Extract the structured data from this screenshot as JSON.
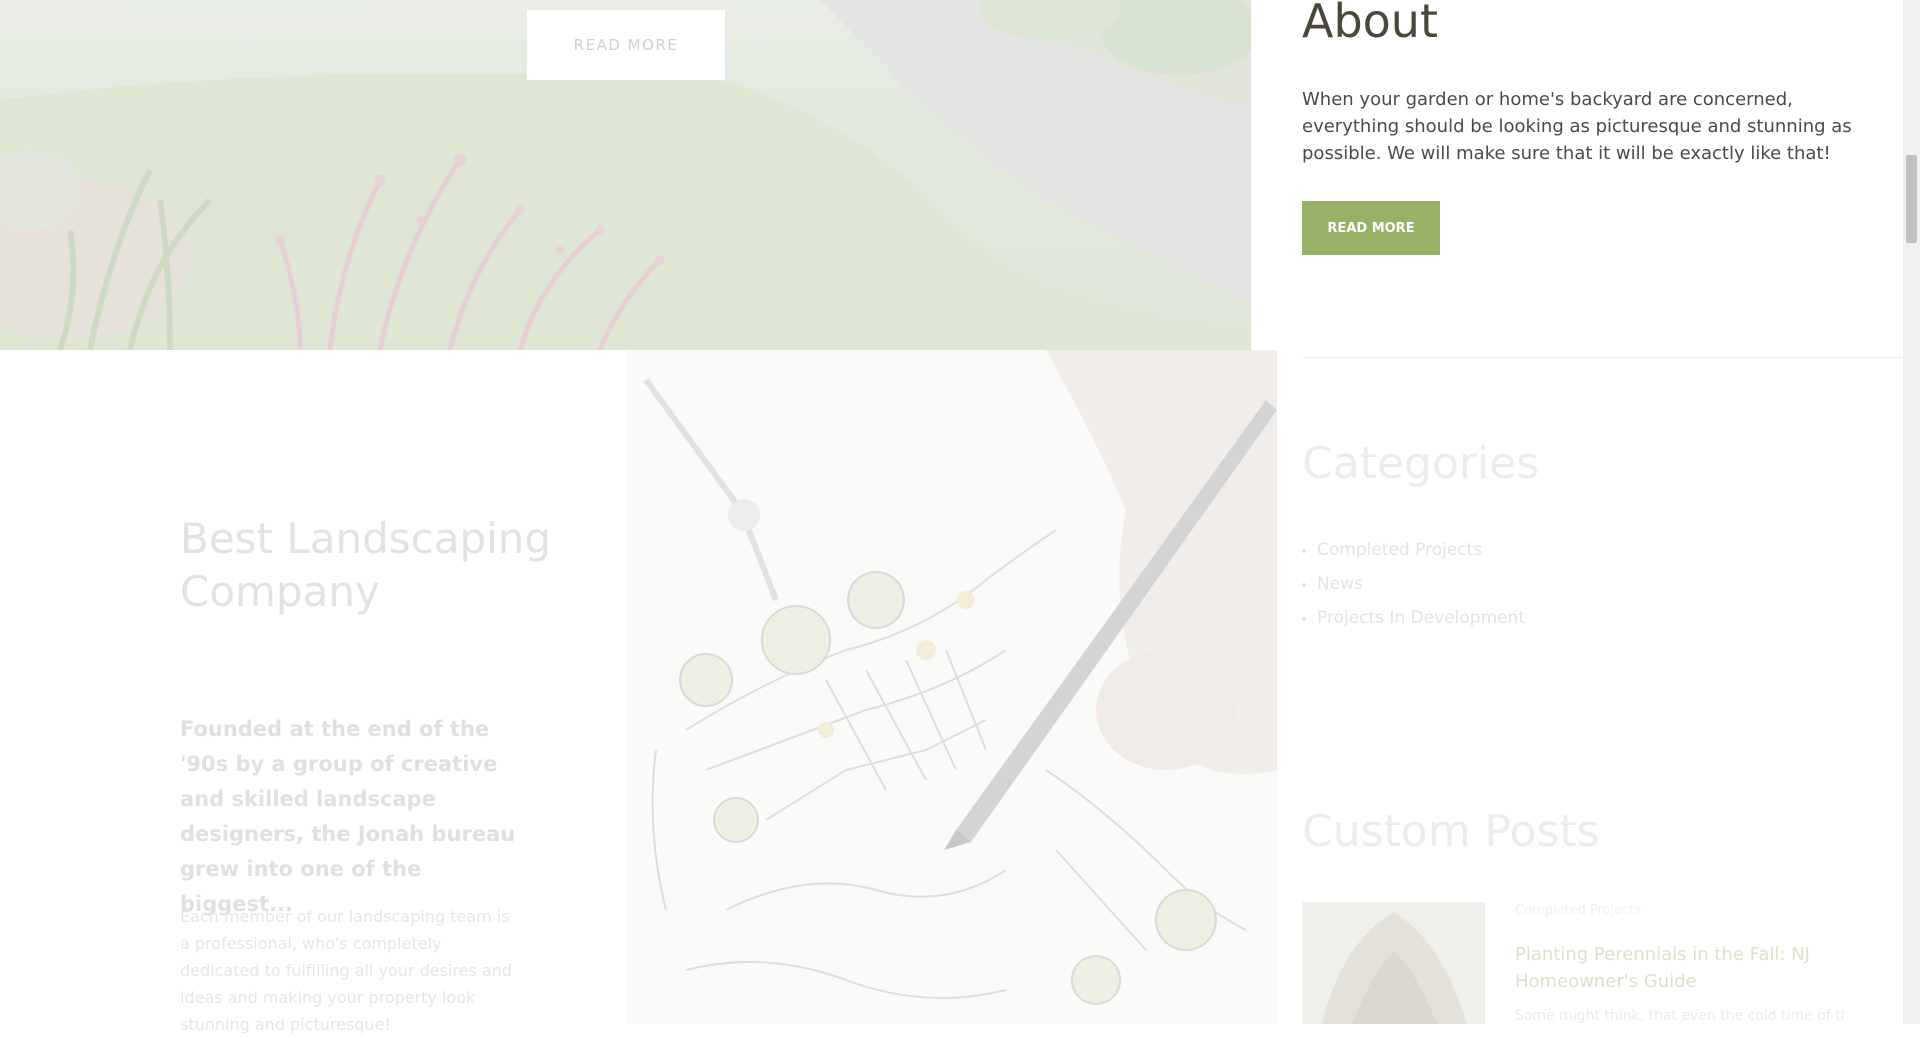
{
  "hero": {
    "button_label": "READ MORE"
  },
  "about": {
    "title": "About",
    "text": "When your garden or home's backyard are concerned, everything should be looking as picturesque and stunning as possible. We will make sure that it will be exactly like that!",
    "button_label": "READ MORE",
    "button_color": "#95b266"
  },
  "company": {
    "title": "Best Landscaping Company",
    "lead": "Founded at the end of the '90s by a group of creative and skilled landscape designers, the Jonah bureau grew into one of the biggest...",
    "body": "Each member of our landscaping team is a professional, who's completely dedicated to fulfilling all your desires and ideas and making your property look stunning and picturesque!"
  },
  "categories": {
    "title": "Categories",
    "items": [
      {
        "label": "Completed Projects"
      },
      {
        "label": "News"
      },
      {
        "label": "Projects In Development"
      }
    ]
  },
  "custom_posts": {
    "title": "Custom Posts",
    "posts": [
      {
        "category": "Completed Projects",
        "title": "Planting Perennials in the Fall: NJ Homeowner's Guide",
        "excerpt": "Some might think, that even the cold time of the..."
      }
    ]
  }
}
